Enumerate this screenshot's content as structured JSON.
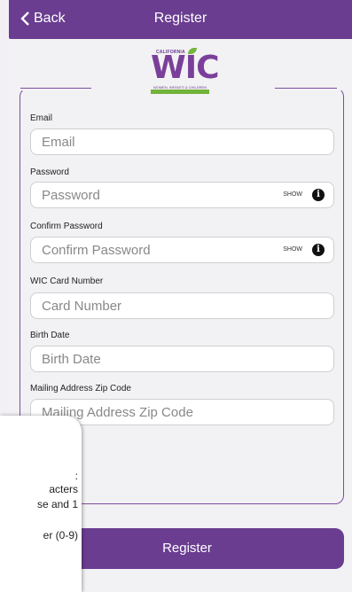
{
  "nav": {
    "back_label": "Back",
    "title": "Register"
  },
  "logo": {
    "top_text": "CALIFORNIA",
    "word": "WIC",
    "tagline": "WOMEN, INFANTS & CHILDREN"
  },
  "form": {
    "email": {
      "label": "Email",
      "placeholder": "Email"
    },
    "password": {
      "label": "Password",
      "placeholder": "Password",
      "show_label": "SHOW"
    },
    "confirm_password": {
      "label": "Confirm Password",
      "placeholder": "Confirm Password",
      "show_label": "SHOW"
    },
    "card_number": {
      "label": "WIC Card Number",
      "placeholder": "Card Number"
    },
    "birth_date": {
      "label": "Birth Date",
      "placeholder": "Birth Date"
    },
    "zip": {
      "label": "Mailing Address Zip Code",
      "placeholder": "Mailing Address Zip Code"
    }
  },
  "register_label": "Register",
  "tooltip": {
    "lines": [
      ":",
      "acters",
      "se and 1",
      "er (0-9)"
    ]
  },
  "colors": {
    "brand": "#6a3d91",
    "accent_green": "#72b33a"
  }
}
